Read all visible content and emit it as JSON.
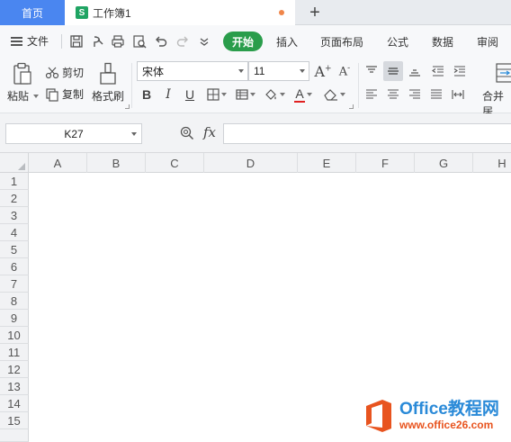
{
  "tabs": {
    "home_label": "首页",
    "doc_icon": "S",
    "doc_title": "工作簿1",
    "new_tab": "+"
  },
  "menu": {
    "file_label": "文件",
    "items": [
      "开始",
      "插入",
      "页面布局",
      "公式",
      "数据",
      "审阅"
    ]
  },
  "ribbon": {
    "paste": "粘贴",
    "cut": "剪切",
    "copy": "复制",
    "format_painter": "格式刷",
    "font_name": "宋体",
    "font_size": "11",
    "bold": "B",
    "italic": "I",
    "underline": "U",
    "font_color_glyph": "A",
    "merge": "合并居"
  },
  "formula_bar": {
    "cell_ref": "K27",
    "fx": "fx",
    "formula_value": ""
  },
  "grid": {
    "columns": [
      "A",
      "B",
      "C",
      "D",
      "E",
      "F",
      "G",
      "H"
    ],
    "rows": [
      "1",
      "2",
      "3",
      "4",
      "5",
      "6",
      "7",
      "8",
      "9",
      "10",
      "11",
      "12",
      "13",
      "14",
      "15"
    ]
  },
  "watermark": {
    "title": "Office教程网",
    "url": "www.office26.com"
  },
  "colors": {
    "home_tab": "#4a86f0",
    "start_pill": "#2a9d4b",
    "sheet_icon": "#1fa463",
    "unsaved_dot": "#f0864a",
    "font_color_bar": "#e02020"
  }
}
